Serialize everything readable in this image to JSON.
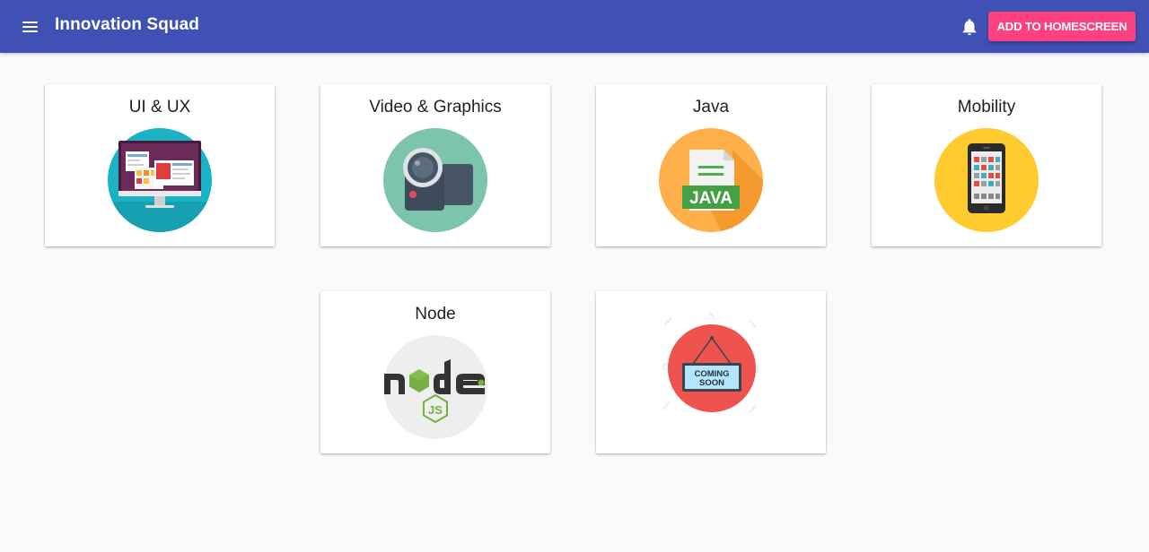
{
  "header": {
    "title": "Innovation Squad",
    "menu_icon": "hamburger-menu-icon",
    "notification_icon": "bell-icon",
    "add_button_label": "ADD TO HOMESCREEN",
    "bar_color": "#3f51b5",
    "accent_color": "#ff4081"
  },
  "cards": [
    {
      "title": "UI & UX",
      "icon": "monitor-icon",
      "icon_bg": "#1ab2c4"
    },
    {
      "title": "Video & Graphics",
      "icon": "video-camera-icon",
      "icon_bg": "#7dc4ad"
    },
    {
      "title": "Java",
      "icon": "java-file-icon",
      "icon_text": "JAVA",
      "icon_bg": "#ffb04a"
    },
    {
      "title": "Mobility",
      "icon": "smartphone-icon",
      "icon_bg": "#ffcb2e"
    },
    {
      "title": "Node",
      "icon": "nodejs-logo-icon",
      "icon_text": "node",
      "icon_bg": "#eeeeee"
    },
    {
      "title": "",
      "icon": "coming-soon-sign-icon",
      "icon_text": "COMING SOON",
      "sign_lines": [
        "COMING",
        "SOON"
      ],
      "icon_bg": "#ef5350"
    }
  ]
}
